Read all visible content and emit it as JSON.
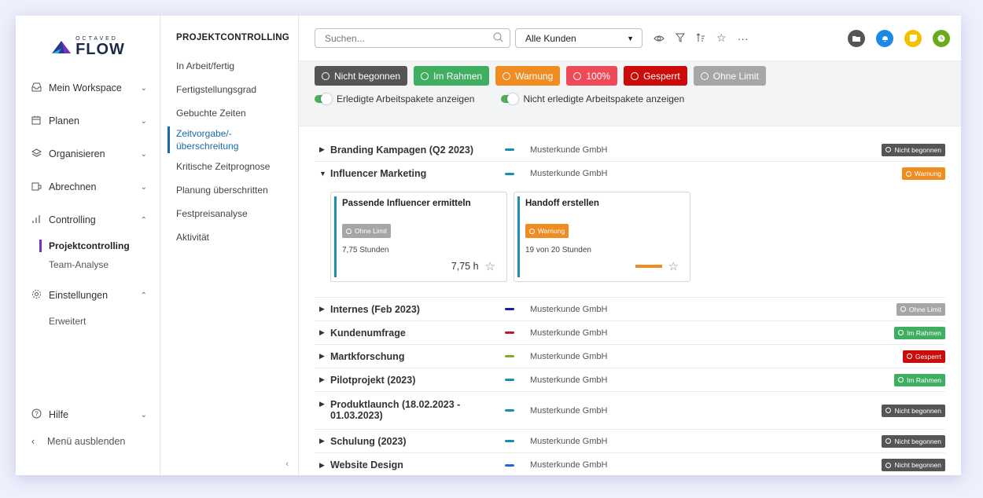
{
  "brand": {
    "small": "OCTAVED",
    "big": "FLOW"
  },
  "sidebar": {
    "items": [
      {
        "label": "Mein Workspace",
        "icon": "inbox-icon",
        "chev": "⌄"
      },
      {
        "label": "Planen",
        "icon": "calendar-icon",
        "chev": "⌄"
      },
      {
        "label": "Organisieren",
        "icon": "layers-icon",
        "chev": "⌄"
      },
      {
        "label": "Abrechnen",
        "icon": "invoice-icon",
        "chev": "⌄"
      },
      {
        "label": "Controlling",
        "icon": "bar-chart-icon",
        "chev": "⌃"
      }
    ],
    "controlling_sub": [
      "Projektcontrolling",
      "Team-Analyse"
    ],
    "settings": {
      "label": "Einstellungen",
      "chev": "⌃"
    },
    "settings_sub": [
      "Erweitert"
    ],
    "help": {
      "label": "Hilfe",
      "chev": "⌄"
    },
    "hide_menu": "Menü ausblenden"
  },
  "subnav": {
    "title": "PROJEKTCONTROLLING",
    "items": [
      "In Arbeit/fertig",
      "Fertigstellungsgrad",
      "Gebuchte Zeiten"
    ],
    "active_line1": "Zeitvorgabe/-",
    "active_line2": "überschreitung",
    "items_after": [
      "Kritische Zeitprognose",
      "Planung überschritten",
      "Festpreisanalyse",
      "Aktivität"
    ]
  },
  "toolbar": {
    "search_placeholder": "Suchen...",
    "customer_select": "Alle Kunden",
    "icons": [
      "eye-icon",
      "filter-icon",
      "sort-icon",
      "star-icon",
      "more-icon"
    ]
  },
  "colors": {
    "nicht_begonnen": "#555555",
    "im_rahmen": "#3fae61",
    "warnung": "#ef8c22",
    "p100": "#ef4a5a",
    "gesperrt": "#cc0b0b",
    "ohne_limit": "#a6a6a6"
  },
  "chips": [
    {
      "label": "Nicht begonnen",
      "color": "#555555"
    },
    {
      "label": "Im Rahmen",
      "color": "#3fae61"
    },
    {
      "label": "Warnung",
      "color": "#ef8c22"
    },
    {
      "label": "100%",
      "color": "#ef4a5a"
    },
    {
      "label": "Gesperrt",
      "color": "#cc0b0b"
    },
    {
      "label": "Ohne Limit",
      "color": "#a6a6a6"
    }
  ],
  "toggles": [
    "Erledigte Arbeitspakete anzeigen",
    "Nicht erledigte Arbeitspakete anzeigen"
  ],
  "projects": [
    {
      "name": "Branding Kampagen (Q2 2023)",
      "customer": "Musterkunde GmbH",
      "status": "Nicht begonnen",
      "dash": "#1a8fb0"
    },
    {
      "name": "Influencer Marketing",
      "customer": "Musterkunde GmbH",
      "status": "Warnung",
      "dash": "#1a8fb0"
    },
    {
      "name": "Internes (Feb 2023)",
      "customer": "Musterkunde GmbH",
      "status": "Ohne Limit",
      "dash": "#1a1aa8"
    },
    {
      "name": "Kundenumfrage",
      "customer": "Musterkunde GmbH",
      "status": "Im Rahmen",
      "dash": "#c0182a"
    },
    {
      "name": "Martkforschung",
      "customer": "Musterkunde GmbH",
      "status": "Gesperrt",
      "dash": "#7fae1a"
    },
    {
      "name": "Pilotprojekt (2023)",
      "customer": "Musterkunde GmbH",
      "status": "Im Rahmen",
      "dash": "#1a8fb0"
    },
    {
      "name": "Produktlaunch (18.02.2023 - 01.03.2023)",
      "customer": "Musterkunde GmbH",
      "status": "Nicht begonnen",
      "dash": "#1a8fb0"
    },
    {
      "name": "Schulung (2023)",
      "customer": "Musterkunde GmbH",
      "status": "Nicht begonnen",
      "dash": "#1a8fb0"
    },
    {
      "name": "Website Design",
      "customer": "Musterkunde GmbH",
      "status": "Nicht begonnen",
      "dash": "#1a6ad8"
    }
  ],
  "cards": [
    {
      "title": "Passende Influencer ermitteln",
      "status": "Ohne Limit",
      "hours": "7,75 Stunden",
      "total": "7,75 h",
      "bar": "#1a8fb0",
      "progress": null
    },
    {
      "title": "Handoff erstellen",
      "status": "Warnung",
      "hours": "19 von 20 Stunden",
      "total": "",
      "bar": "#1a8fb0",
      "progress": 0.95
    }
  ]
}
